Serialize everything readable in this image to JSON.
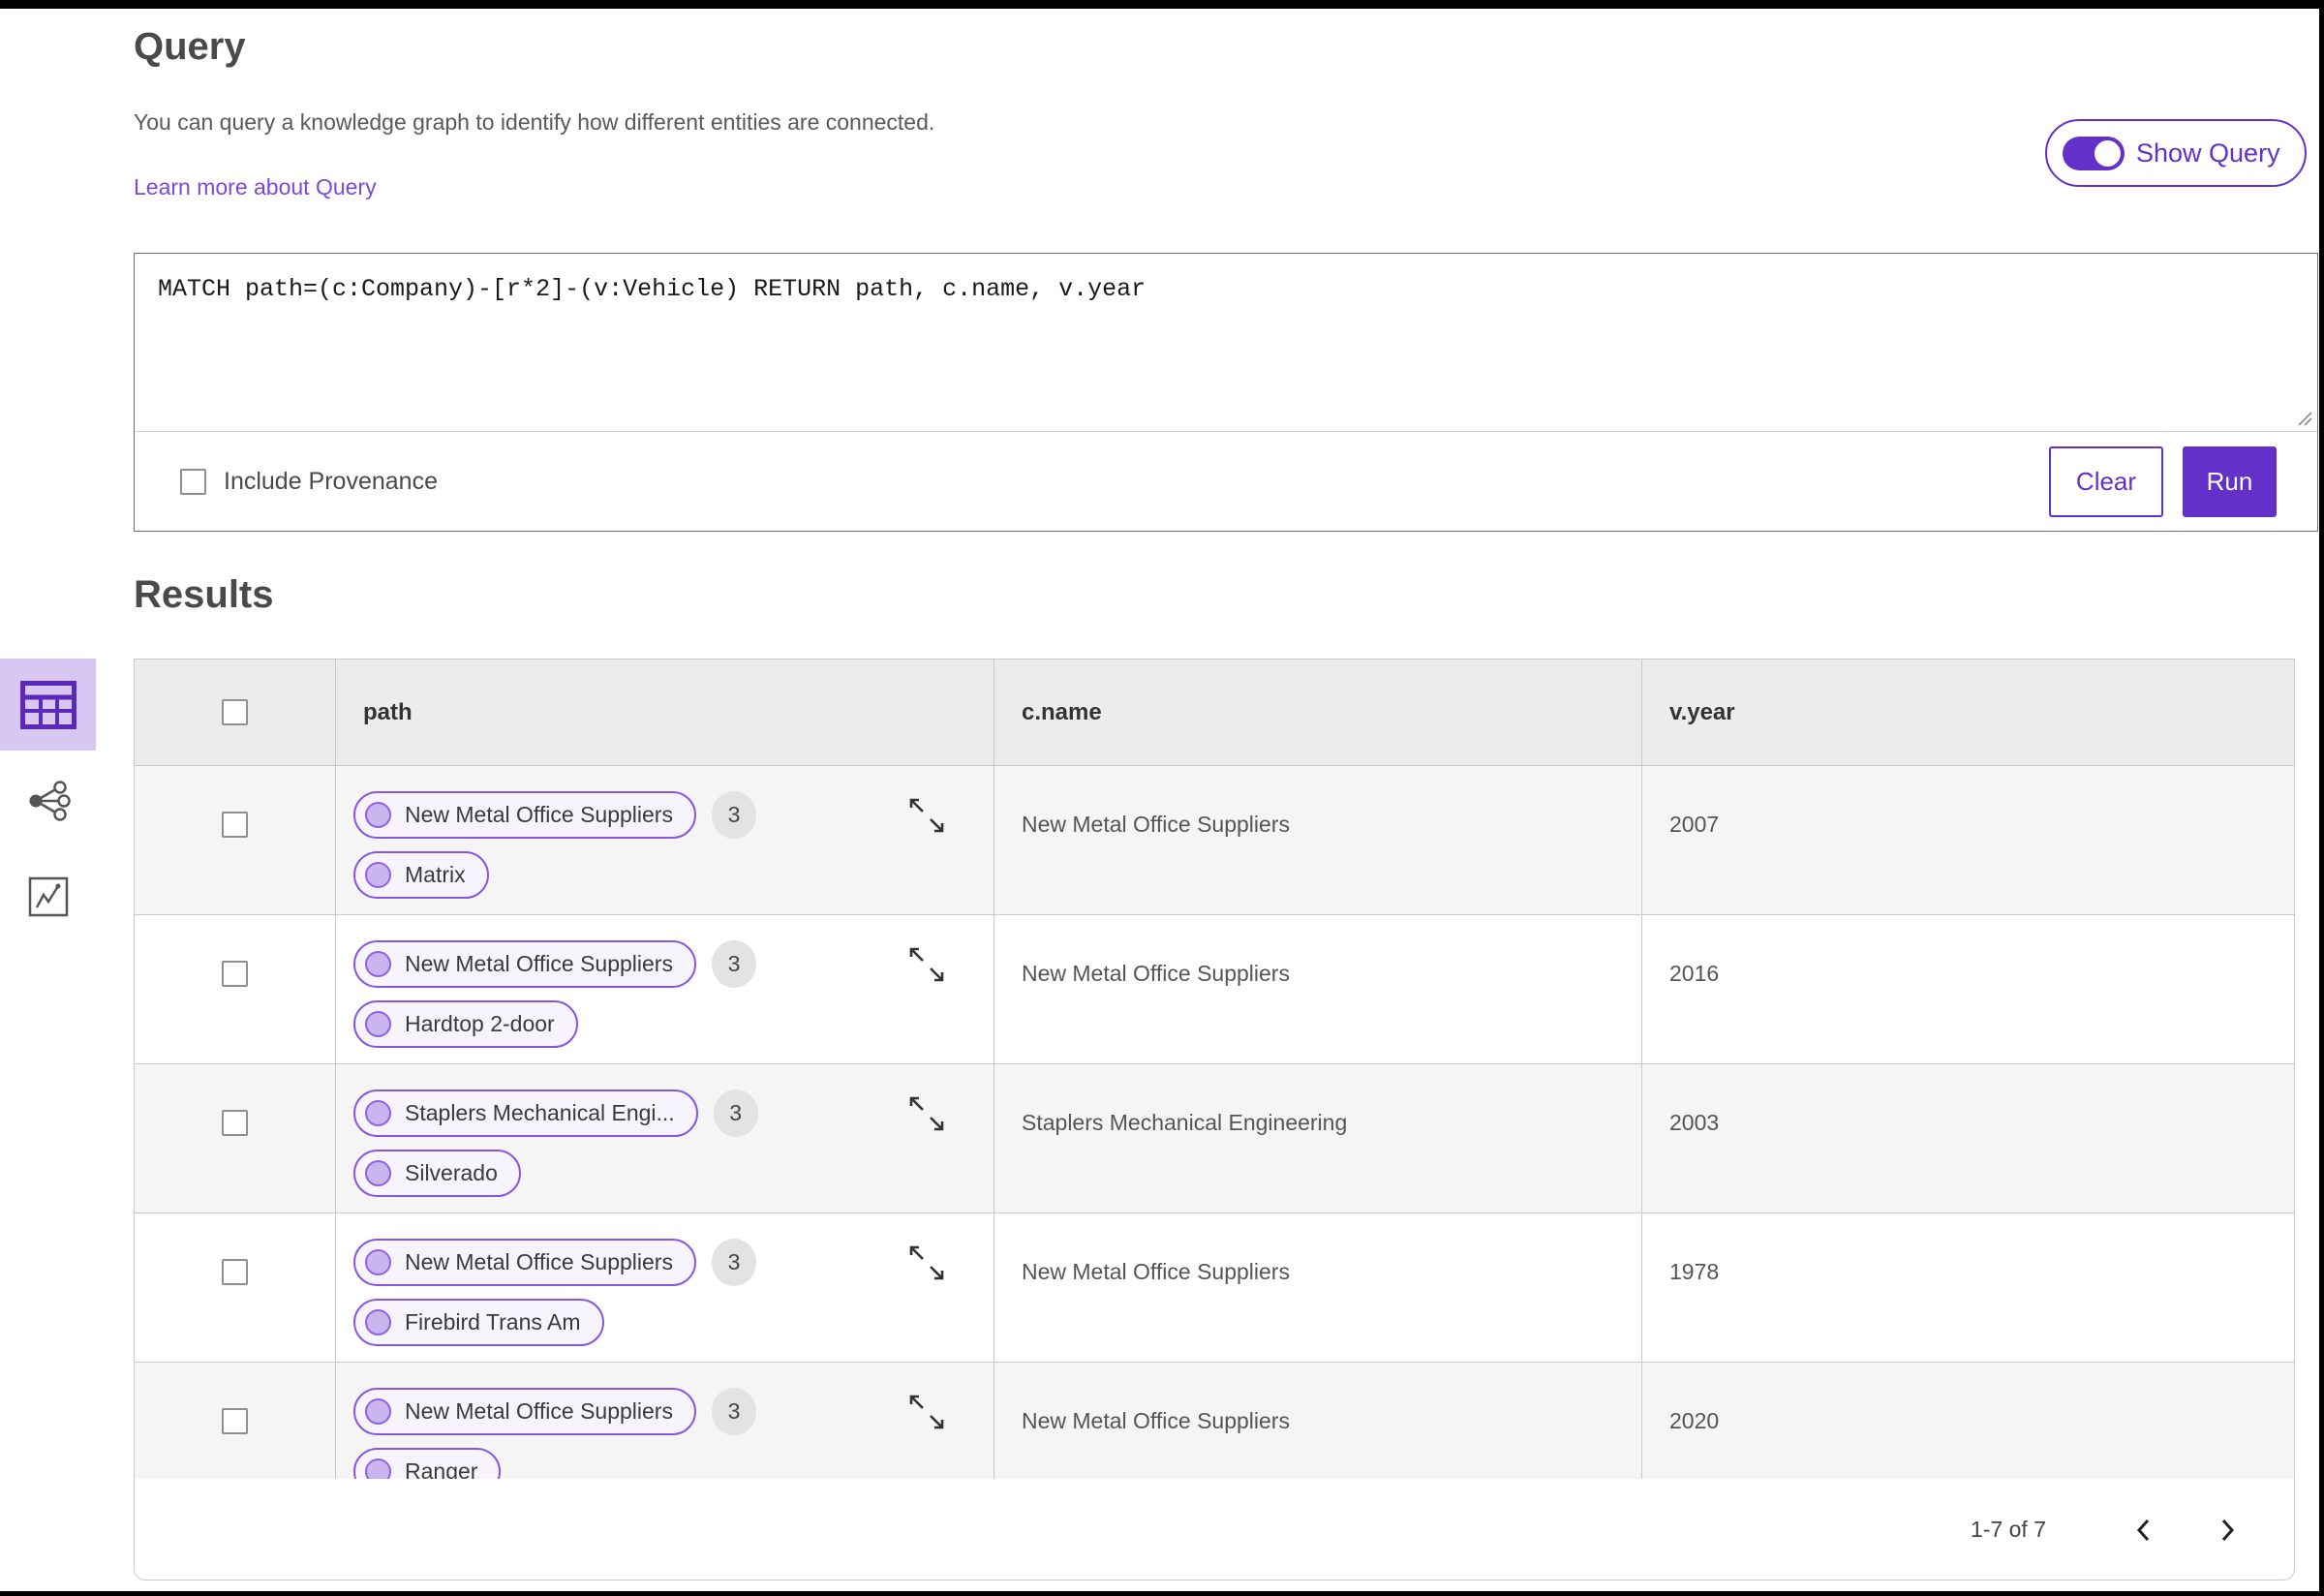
{
  "query_section": {
    "title": "Query",
    "description": "You can query a knowledge graph to identify how different entities are connected.",
    "learn_more_link": "Learn more about Query",
    "show_query_label": "Show Query",
    "show_query_toggle_state": "on",
    "query_text": "MATCH path=(c:Company)-[r*2]-(v:Vehicle) RETURN path, c.name, v.year",
    "include_provenance_label": "Include Provenance",
    "include_provenance_checked": false,
    "clear_label": "Clear",
    "run_label": "Run"
  },
  "results_section": {
    "title": "Results",
    "view_switcher": {
      "items": [
        {
          "icon": "table-view-icon",
          "selected": true
        },
        {
          "icon": "graph-view-icon",
          "selected": false
        },
        {
          "icon": "scatter-chart-view-icon",
          "selected": false
        }
      ]
    },
    "table": {
      "columns": [
        "path",
        "c.name",
        "v.year"
      ],
      "rows": [
        {
          "path_nodes": [
            "New Metal Office Suppliers",
            "Matrix"
          ],
          "count": "3",
          "c_name": "New Metal Office Suppliers",
          "v_year": "2007"
        },
        {
          "path_nodes": [
            "New Metal Office Suppliers",
            "Hardtop 2-door"
          ],
          "count": "3",
          "c_name": "New Metal Office Suppliers",
          "v_year": "2016"
        },
        {
          "path_nodes": [
            "Staplers Mechanical Engi...",
            "Silverado"
          ],
          "count": "3",
          "c_name": "Staplers Mechanical Engineering",
          "v_year": "2003"
        },
        {
          "path_nodes": [
            "New Metal Office Suppliers",
            "Firebird Trans Am"
          ],
          "count": "3",
          "c_name": "New Metal Office Suppliers",
          "v_year": "1978"
        },
        {
          "path_nodes": [
            "New Metal Office Suppliers",
            "Ranger"
          ],
          "count": "3",
          "c_name": "New Metal Office Suppliers",
          "v_year": "2020"
        }
      ],
      "pagination": {
        "range_label": "1-7 of 7"
      }
    }
  },
  "colors": {
    "accent_purple": "#6331c9",
    "link_purple": "#7a4ae0",
    "pill_border": "#8655e2",
    "pill_bg": "#f7f4fd",
    "node_fill": "#cab5ee",
    "selected_icon_bg": "#d8c7f3",
    "row_alt_bg": "#f5f5f5",
    "header_bg": "#ececec"
  }
}
